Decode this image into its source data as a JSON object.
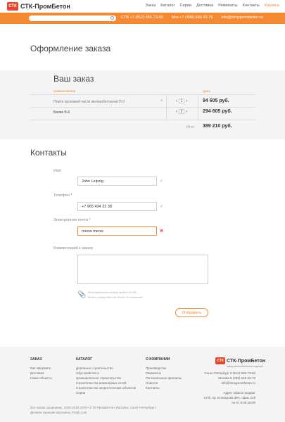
{
  "header": {
    "logo_mark": "СТК",
    "logo_text": "СТК-ПромБетон",
    "nav": [
      "Заказ",
      "Каталог",
      "Серии",
      "Доставка",
      "Реквизиты",
      "Контакты",
      "Корзина"
    ],
    "phone_spb": "СПб +7 (812) 655-73-60",
    "phone_msk": "Мск +7 (499) 649-33-79",
    "email": "info@stroyprombeton.ru"
  },
  "page_title": "Оформление заказа",
  "order": {
    "title": "Ваш заказ",
    "col_name": "Наименование",
    "col_price": "Цена",
    "items": [
      {
        "name": "Плита проезжей части железобетонная П-3",
        "qty": "1",
        "price": "94 605 руб."
      },
      {
        "name": "Балка Б-6",
        "qty": "2",
        "price": "294 605 руб."
      }
    ],
    "total_label": "Итог:",
    "total_value": "389 210 руб."
  },
  "contacts": {
    "title": "Контакты",
    "name_label": "Имя",
    "name_value": "John Leipzig",
    "phone_label": "Телефон",
    "phone_value": "+7 965 434 32 38",
    "email_label": "Электронная почта",
    "email_value": "meow meow",
    "comment_label": "Комментарий к заказу",
    "hint_line1": "Максимальный размер файла 25 МБ",
    "hint_line2": "Можно прикрепить не более 10 вложений",
    "send_label": "Отправить"
  },
  "footer": {
    "col1_title": "ЗАКАЗ",
    "col1_links": [
      "Как оформить",
      "Доставка",
      "Наши объекты"
    ],
    "col2_title": "КАТАЛОГ",
    "col2_links": [
      "Дорожное строительство",
      "Обустройство и",
      "промышленное строительство",
      "Строительство инженерных сетей",
      "Строительство энергетических объектов",
      "Серии"
    ],
    "col3_title": "О КОМПАНИИ",
    "col3_links": [
      "Производство",
      "Реквизиты",
      "Региональные филиалы",
      "Новости",
      "Контакты"
    ],
    "logo_text": "СТК-ПромБетон",
    "logo_tag": "завод железобетонных изделий",
    "contact_lines": [
      "Санкт-Петербург 8 (812) 655-73-60",
      "Москва 8 (499) 649-33-79",
      "info@stroyprombeton.ru",
      "",
      "Адрес офиса продаж:",
      "СПб, пр. Елизарова 38А, офис 218",
      "пн-пт 9:00-18:00"
    ],
    "copy_line1": "Все права защищены, 2009-2016 ООО «СТК-ПромБетон» (Москва, Санкт-Петербург)",
    "copy_line2": "Делаем хорошие магазины, Fstab.com"
  }
}
